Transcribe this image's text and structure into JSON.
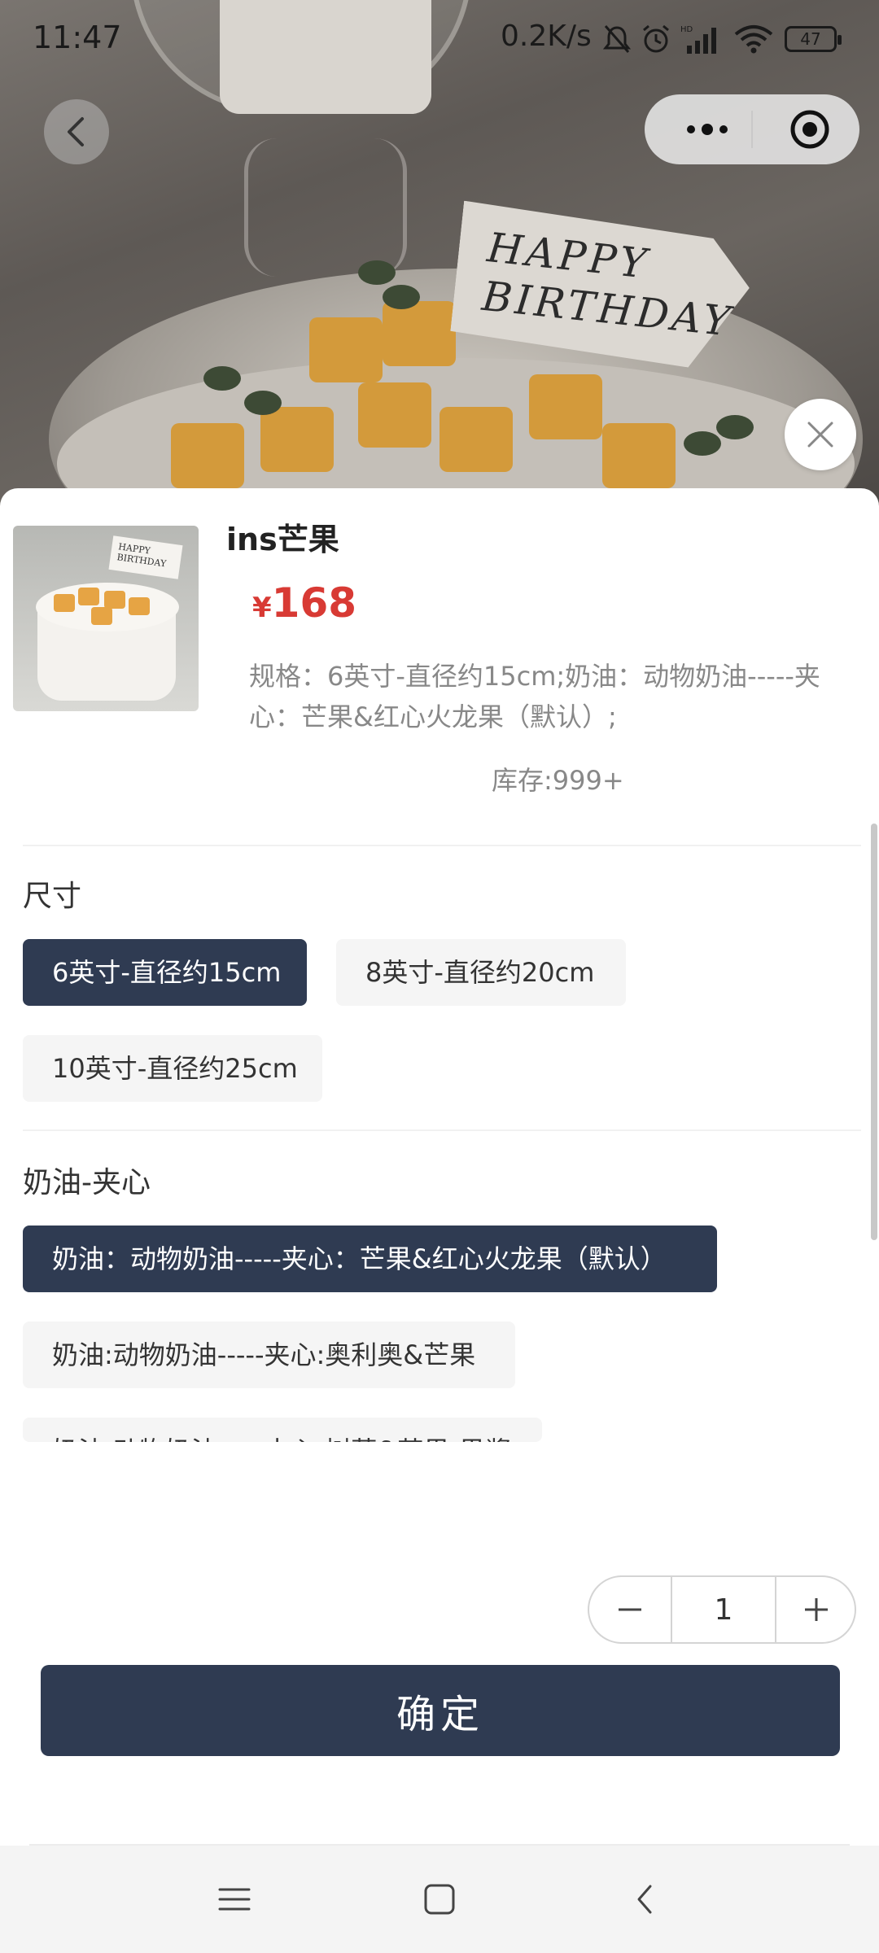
{
  "status_bar": {
    "time": "11:47",
    "network_speed": "0.2K/s",
    "battery": "47",
    "icons": [
      "mute-icon",
      "alarm-icon",
      "signal-icon",
      "wifi-icon",
      "battery-icon"
    ]
  },
  "hero": {
    "topper_line1": "HAPPY",
    "topper_line2": "BIRTHDAY"
  },
  "product": {
    "title": "ins芒果",
    "currency": "¥",
    "price": "168",
    "spec": "规格：6英寸-直径约15cm;奶油：动物奶油-----夹心：芒果&红心火龙果（默认）;",
    "stock": "库存:999+",
    "thumb_flag_line1": "HAPPY",
    "thumb_flag_line2": "BIRTHDAY"
  },
  "size_section": {
    "title": "尺寸",
    "options": [
      {
        "label": "6英寸-直径约15cm",
        "selected": true
      },
      {
        "label": "8英寸-直径约20cm",
        "selected": false
      },
      {
        "label": "10英寸-直径约25cm",
        "selected": false
      }
    ]
  },
  "filling_section": {
    "title": "奶油-夹心",
    "options": [
      {
        "label": "奶油：动物奶油-----夹心：芒果&红心火龙果（默认）",
        "selected": true
      },
      {
        "label": "奶油:动物奶油-----夹心:奥利奥&芒果",
        "selected": false
      },
      {
        "label": "奶油:动物奶油-----夹心:树莓&芒果-果酱",
        "selected": false
      }
    ]
  },
  "quantity": {
    "value": "1"
  },
  "confirm_label": "确定",
  "colors": {
    "primary": "#2f3b52",
    "price": "#d83a34",
    "chip_off": "#f5f5f5"
  }
}
